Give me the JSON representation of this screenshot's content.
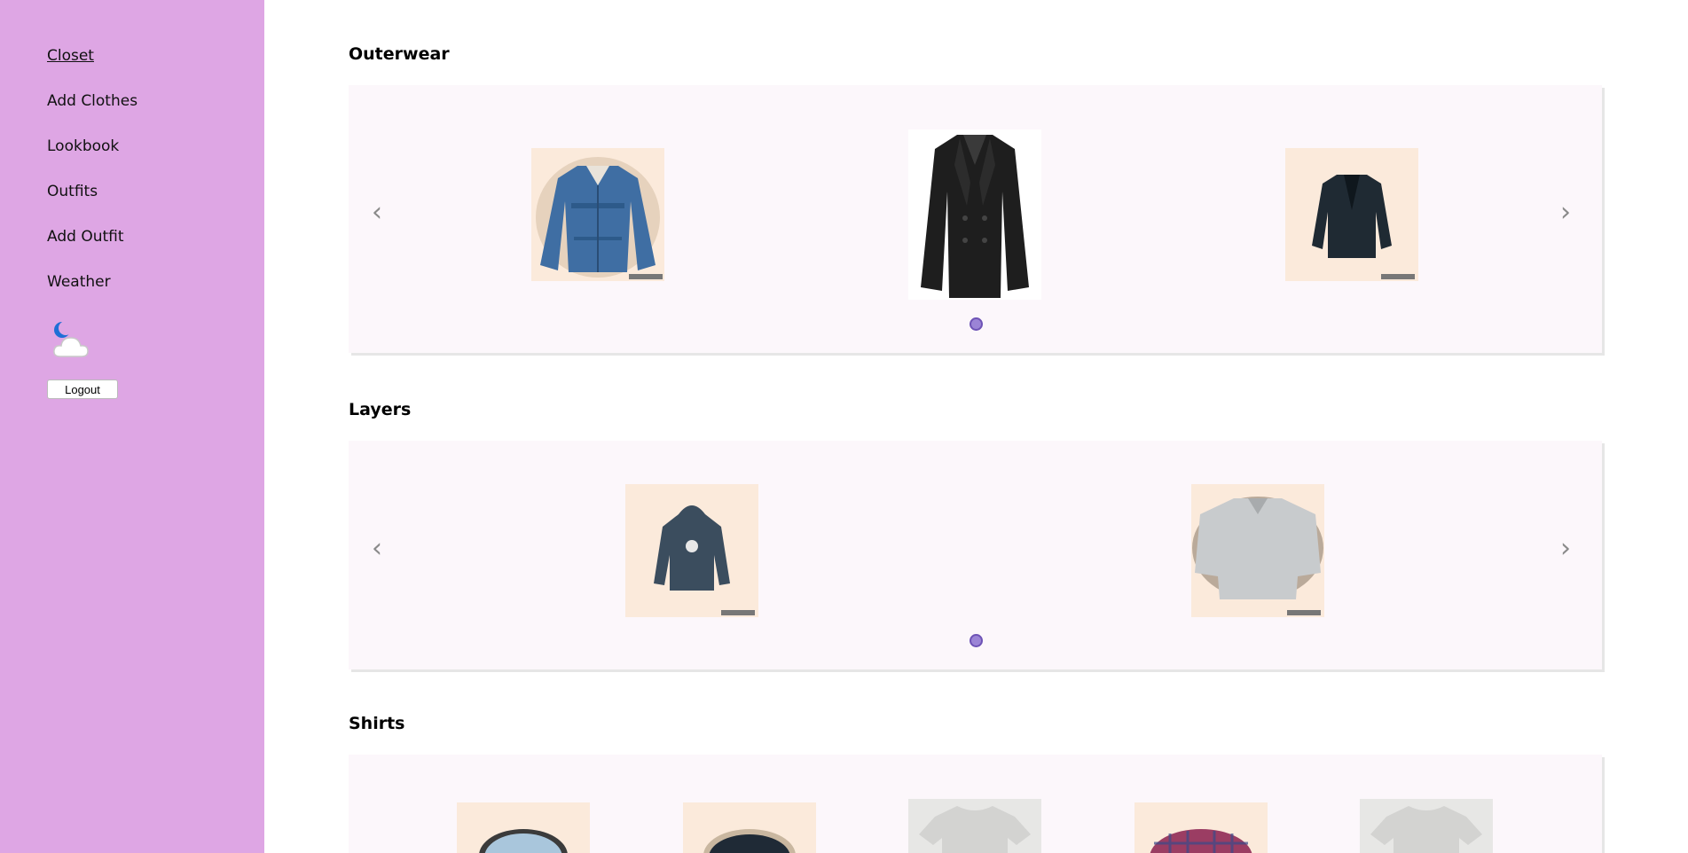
{
  "sidebar": {
    "nav": [
      {
        "label": "Closet",
        "active": true
      },
      {
        "label": "Add Clothes"
      },
      {
        "label": "Lookbook"
      },
      {
        "label": "Outfits"
      },
      {
        "label": "Add Outfit"
      },
      {
        "label": "Weather"
      }
    ],
    "weather_icon": "moon-cloud-icon",
    "logout_label": "Logout"
  },
  "sections": [
    {
      "title": "Outerwear",
      "items": [
        "denim-jacket",
        "black-peacoat",
        "dark-cardigan"
      ],
      "active_page": 1
    },
    {
      "title": "Layers",
      "items": [
        "navy-hoodie",
        "grey-sweater"
      ],
      "active_page": 1
    },
    {
      "title": "Shirts",
      "items": [
        "light-blue-shirt",
        "navy-top",
        "white-tshirt",
        "plaid-shirt",
        "white-tshirt"
      ]
    }
  ],
  "icons": {
    "prev": "‹",
    "next": "›"
  },
  "colors": {
    "sidebar": "#dea6e4",
    "carousel": "#fcf7fb",
    "item_bg": "#fbeadb",
    "dot": "#9b84d6"
  }
}
